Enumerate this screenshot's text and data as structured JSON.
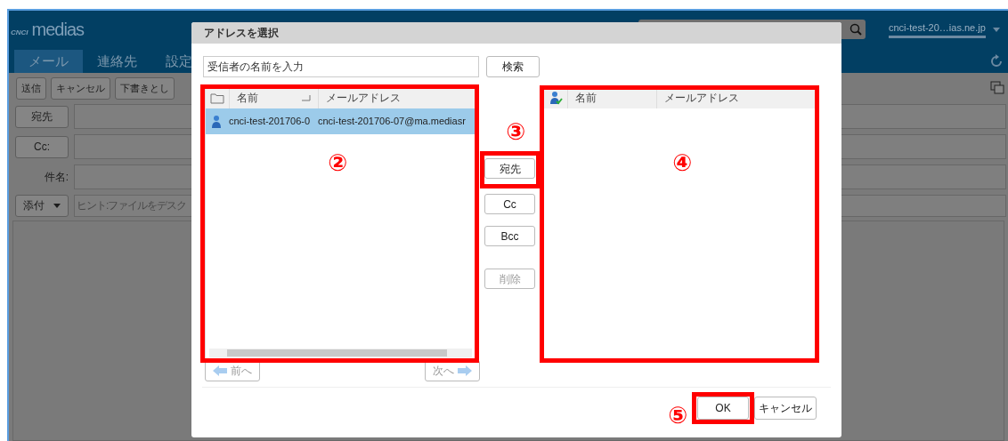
{
  "app": {
    "brand_mark": "CNCI",
    "brand": "medias",
    "account": "cnci-test-20…ias.ne.jp",
    "tabs": [
      {
        "label": "メール",
        "selected": true
      },
      {
        "label": "連絡先",
        "selected": false
      },
      {
        "label": "設定",
        "selected": false
      }
    ],
    "toolbar": [
      "送信",
      "キャンセル",
      "下書きとし"
    ],
    "fields": [
      {
        "kind": "button",
        "label": "宛先"
      },
      {
        "kind": "button",
        "label": "Cc:"
      },
      {
        "kind": "label",
        "label": "件名:"
      },
      {
        "kind": "dropdown",
        "label": "添付",
        "placeholder": "ヒント:ファイルをデスク"
      }
    ]
  },
  "dialog": {
    "title": "アドレスを選択",
    "search": {
      "placeholder": "受信者の名前を入力"
    },
    "search_button": "検索",
    "source": {
      "columns": [
        "名前",
        "メールアドレス"
      ],
      "rows": [
        {
          "name": "cnci-test-201706-0",
          "email": "cnci-test-201706-07@ma.mediasr",
          "selected": true
        }
      ]
    },
    "pager": {
      "prev": {
        "label": "前へ",
        "disabled": true
      },
      "next": {
        "label": "次へ",
        "disabled": true
      }
    },
    "actions": [
      {
        "label": "宛先",
        "disabled": false
      },
      {
        "label": "Cc",
        "disabled": false
      },
      {
        "label": "Bcc",
        "disabled": false
      },
      {
        "label": "削除",
        "disabled": true
      }
    ],
    "recipients": {
      "columns": [
        "名前",
        "メールアドレス"
      ]
    },
    "footer_buttons": [
      "OK",
      "キャンセル"
    ]
  },
  "annotations": {
    "source": "②",
    "actions": "③",
    "recipients": "④",
    "ok": "⑤"
  }
}
